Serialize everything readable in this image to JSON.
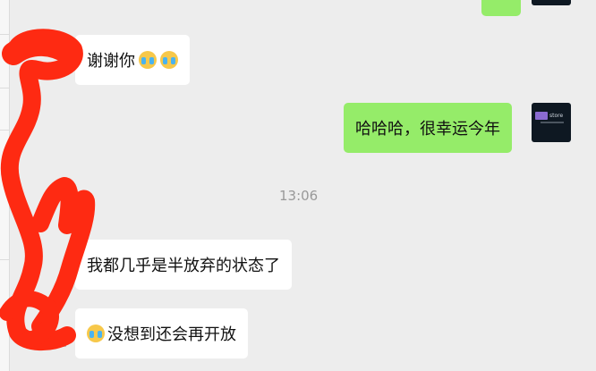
{
  "messages": {
    "thanks": "谢谢你",
    "lucky": "哈哈哈，很幸运今年",
    "gave_up": "我都几乎是半放弃的状态了",
    "reopen": "没想到还会再开放"
  },
  "timestamp": "13:06",
  "avatar": {
    "brand_text": "store"
  },
  "icons": {
    "emoji": "crying-face-icon",
    "avatar_logo": "store-logo-icon"
  },
  "colors": {
    "chat_bg": "#ededed",
    "incoming_bubble": "#ffffff",
    "outgoing_bubble": "#95ec69",
    "redaction": "#fe2a12"
  }
}
